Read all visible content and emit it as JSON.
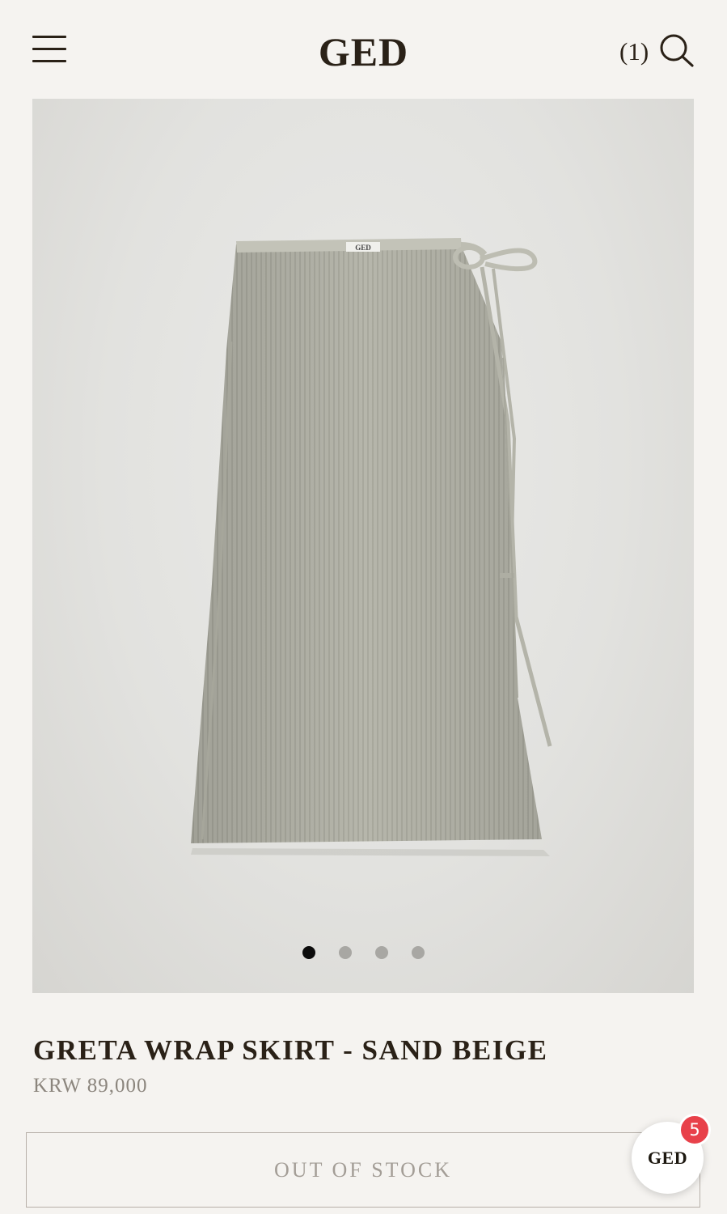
{
  "header": {
    "logo": "GED",
    "cart_count": "(1)",
    "icons": [
      "hamburger-menu-icon",
      "search-icon"
    ]
  },
  "gallery": {
    "label_on_garment": "GED",
    "slides_total": 4,
    "active_slide": 1
  },
  "product": {
    "title": "GRETA WRAP SKIRT - SAND BEIGE",
    "price": "KRW 89,000",
    "status_button": "OUT OF STOCK"
  },
  "chat": {
    "label": "GED",
    "badge_count": "5"
  },
  "colors": {
    "background": "#f5f3f0",
    "text": "#2a2117",
    "price": "#8b857d",
    "badge": "#e8414a"
  }
}
